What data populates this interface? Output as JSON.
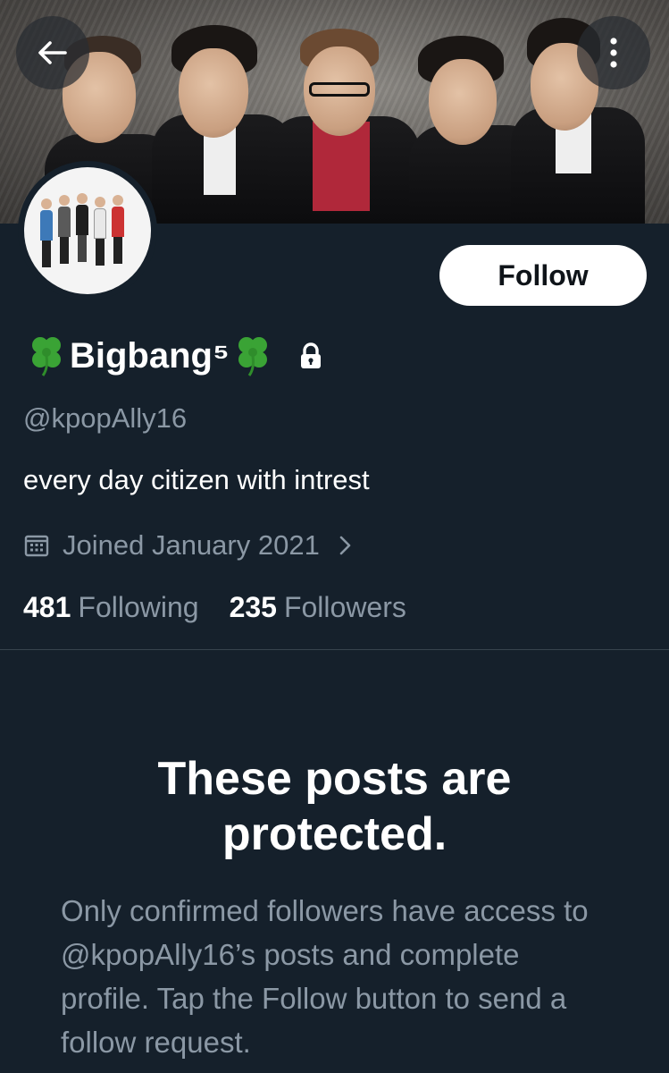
{
  "profile": {
    "display_name": "Bigbang⁵",
    "handle": "@kpopAlly16",
    "bio": "every day citizen with intrest",
    "joined": "Joined January 2021",
    "following_count": "481",
    "following_label": "Following",
    "followers_count": "235",
    "followers_label": "Followers"
  },
  "actions": {
    "follow_label": "Follow"
  },
  "protected": {
    "title": "These posts are protected.",
    "description": "Only confirmed followers have access to @kpopAlly16’s posts and complete profile. Tap the Follow button to send a follow request."
  },
  "icons": {
    "back": "arrow-left-icon",
    "more": "more-vertical-icon",
    "lock": "lock-icon",
    "calendar": "calendar-icon",
    "chevron": "chevron-right-icon",
    "clover": "four-leaf-clover-icon"
  },
  "colors": {
    "background": "#15202b",
    "text": "#ffffff",
    "secondary_text": "#8b98a5",
    "divider": "#38444d",
    "clover_green": "#3aa335"
  }
}
